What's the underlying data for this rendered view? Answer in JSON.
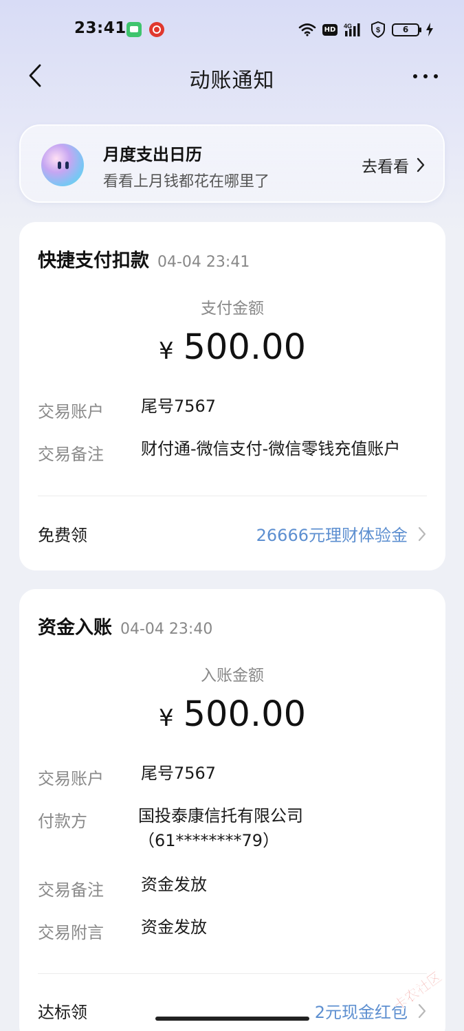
{
  "status_bar": {
    "time": "23:41",
    "network": "4G",
    "hd": "HD",
    "battery": "6"
  },
  "nav": {
    "title": "动账通知"
  },
  "promo": {
    "title": "月度支出日历",
    "subtitle": "看看上月钱都花在哪里了",
    "cta": "去看看"
  },
  "card1": {
    "title": "快捷支付扣款",
    "time": "04-04 23:41",
    "amount_label": "支付金额",
    "currency": "¥",
    "amount": "500.00",
    "rows": [
      {
        "label": "交易账户",
        "value": "尾号7567"
      },
      {
        "label": "交易备注",
        "value": "财付通-微信支付-微信零钱充值账户"
      }
    ],
    "offer_label": "免费领",
    "offer_link": "26666元理财体验金"
  },
  "card2": {
    "title": "资金入账",
    "time": "04-04 23:40",
    "amount_label": "入账金额",
    "currency": "¥",
    "amount": "500.00",
    "rows": [
      {
        "label": "交易账户",
        "value": "尾号7567"
      },
      {
        "label": "付款方",
        "value": "国投泰康信托有限公司（61********79）"
      },
      {
        "label": "交易备注",
        "value": "资金发放"
      },
      {
        "label": "交易附言",
        "value": "资金发放"
      }
    ],
    "offer_label": "达标领",
    "offer_link": "2元现金红包"
  },
  "watermark": "卡农社区",
  "colors": {
    "link": "#5d8fd0",
    "accent_red": "#e0413a"
  }
}
